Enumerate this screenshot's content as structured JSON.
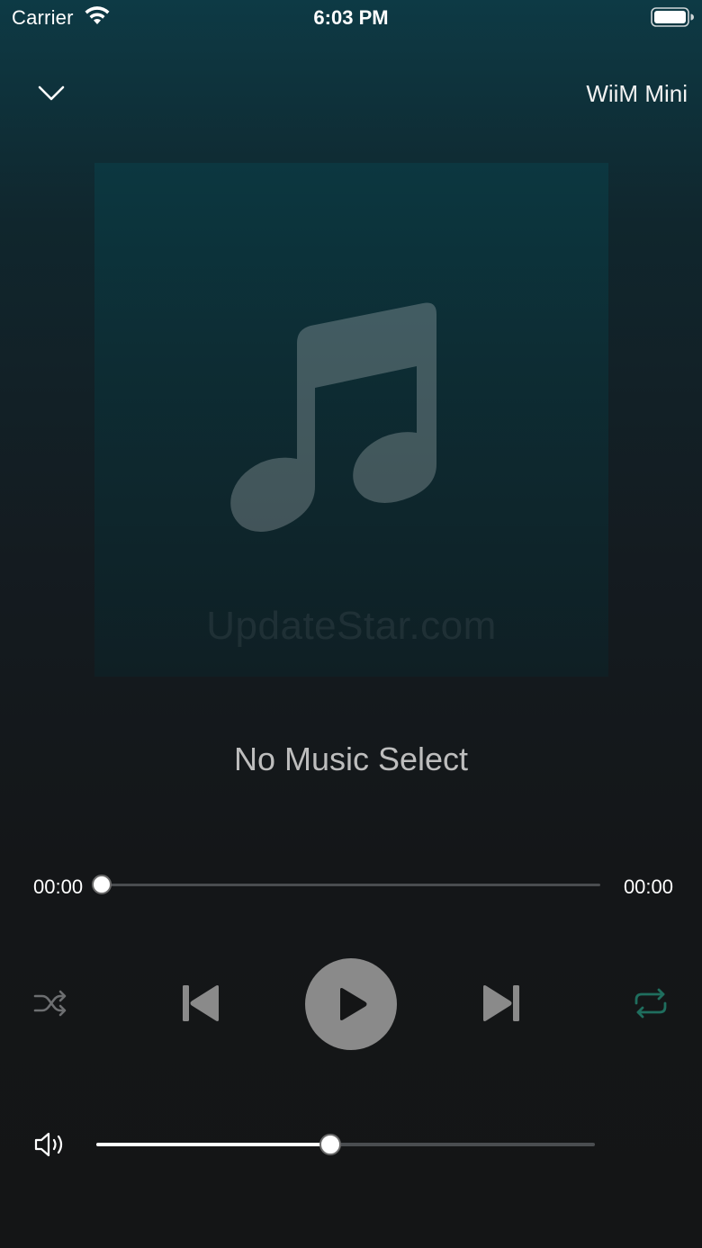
{
  "status_bar": {
    "carrier": "Carrier",
    "time": "6:03 PM",
    "wifi_icon": "wifi-icon",
    "battery_icon": "battery-full-icon"
  },
  "header": {
    "collapse_icon": "chevron-down-icon",
    "device_name": "WiiM Mini"
  },
  "artwork": {
    "placeholder_icon": "music-note-icon",
    "watermark": "UpdateStar.com"
  },
  "track": {
    "title": "No Music Select"
  },
  "progress": {
    "elapsed": "00:00",
    "total": "00:00",
    "fraction": 0.0
  },
  "controls": {
    "shuffle_icon": "shuffle-icon",
    "previous_icon": "skip-previous-icon",
    "play_icon": "play-icon",
    "next_icon": "skip-next-icon",
    "repeat_icon": "repeat-icon"
  },
  "volume": {
    "icon": "speaker-volume-icon",
    "fraction": 0.47
  },
  "colors": {
    "accent_teal": "#1f6e5e",
    "text_primary": "#ffffff",
    "text_muted": "#bdbdbd",
    "control_gray": "#8a8a8a"
  }
}
